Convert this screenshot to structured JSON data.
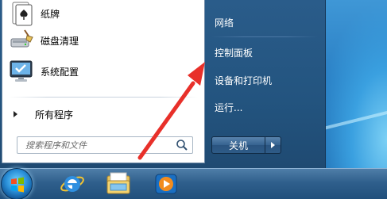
{
  "start_menu": {
    "programs": [
      {
        "label": "纸牌",
        "icon": "solitaire-icon"
      },
      {
        "label": "磁盘清理",
        "icon": "disk-cleanup-icon"
      },
      {
        "label": "系统配置",
        "icon": "system-config-icon"
      }
    ],
    "all_programs_label": "所有程序",
    "search": {
      "placeholder": "搜索程序和文件"
    },
    "right_items": [
      {
        "label": "网络"
      },
      {
        "label": "控制面板"
      },
      {
        "label": "设备和打印机"
      },
      {
        "label": "运行..."
      }
    ],
    "shutdown_label": "关机"
  },
  "taskbar": {
    "pinned": [
      {
        "name": "internet-explorer-icon"
      },
      {
        "name": "windows-explorer-icon"
      },
      {
        "name": "media-player-icon"
      }
    ]
  },
  "colors": {
    "annotation_arrow": "#e8302a",
    "menu_right_bg": "#23547f",
    "taskbar": "#2f5f8c"
  }
}
